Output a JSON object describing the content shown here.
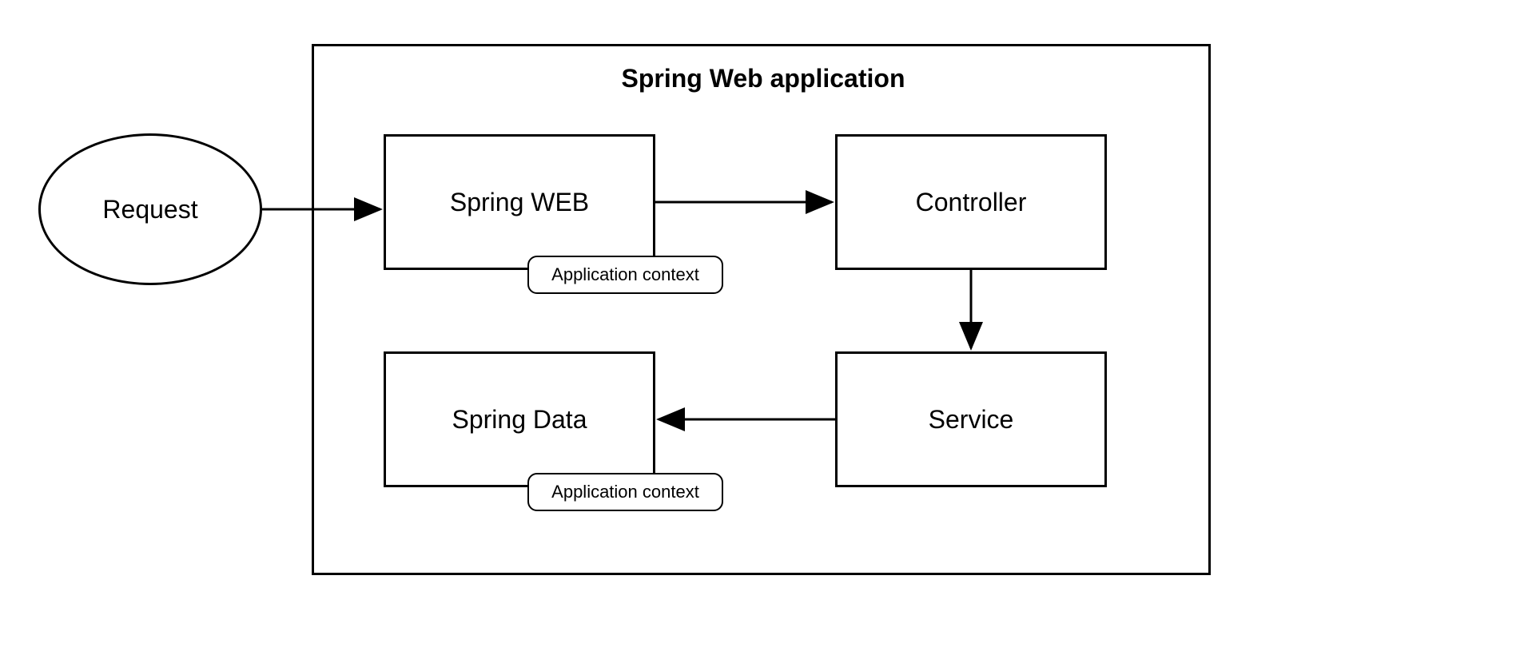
{
  "diagram": {
    "container_title": "Spring Web application",
    "request_label": "Request",
    "spring_web_label": "Spring WEB",
    "controller_label": "Controller",
    "service_label": "Service",
    "spring_data_label": "Spring Data",
    "app_context_1": "Application context",
    "app_context_2": "Application context"
  }
}
